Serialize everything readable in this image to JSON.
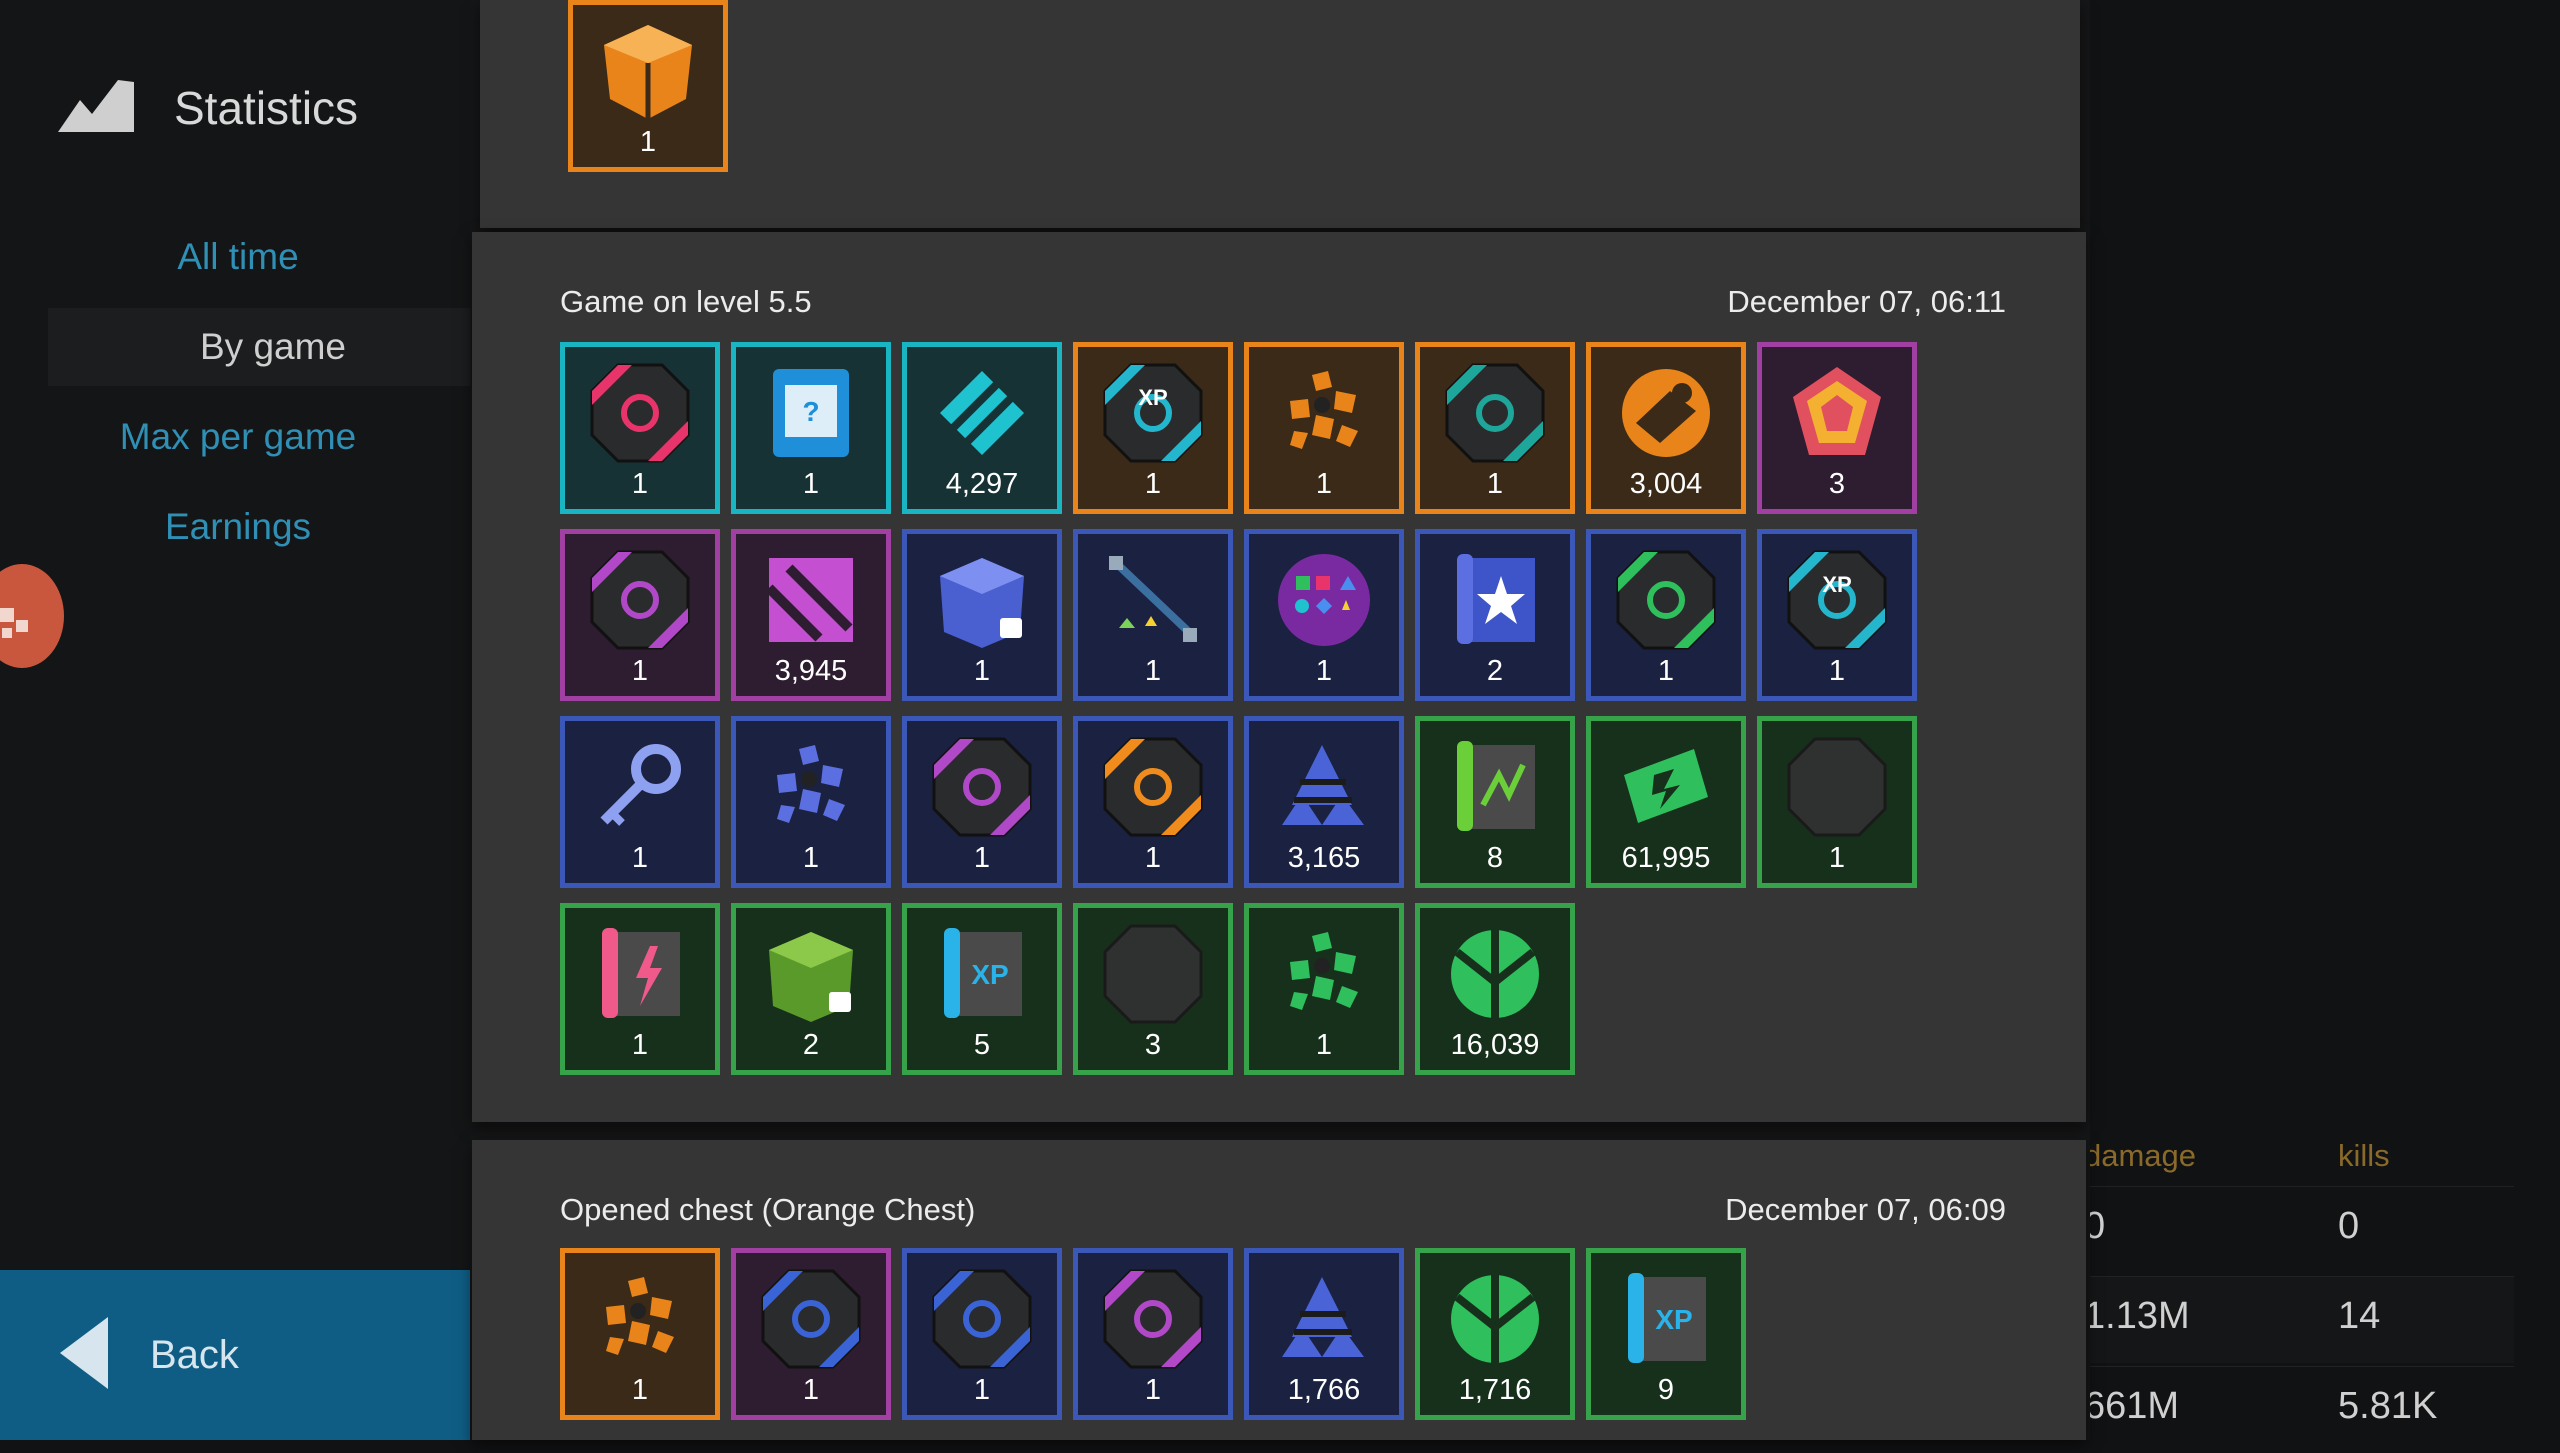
{
  "sidebar": {
    "title": "Statistics",
    "nav": [
      "All time",
      "By game",
      "Max per game",
      "Earnings"
    ],
    "active_nav": "By game",
    "back_label": "Back"
  },
  "top_card": {
    "items": [
      {
        "rarity": "orange",
        "icon": "orange-chest-icon",
        "count": "1"
      }
    ]
  },
  "game_card": {
    "title": "Game on level 5.5",
    "date": "December 07, 06:11",
    "items": [
      {
        "rarity": "cyan",
        "icon": "module-pink-icon",
        "count": "1"
      },
      {
        "rarity": "cyan",
        "icon": "booster-card-icon",
        "count": "1"
      },
      {
        "rarity": "cyan",
        "icon": "cyan-shards-icon",
        "count": "4,297"
      },
      {
        "rarity": "orange",
        "icon": "xp-module-icon",
        "count": "1"
      },
      {
        "rarity": "orange",
        "icon": "orange-gems-icon",
        "count": "1"
      },
      {
        "rarity": "orange",
        "icon": "module-teal-icon",
        "count": "1"
      },
      {
        "rarity": "orange",
        "icon": "orange-tokens-icon",
        "count": "3,004"
      },
      {
        "rarity": "purple",
        "icon": "purple-crystal-icon",
        "count": "3"
      },
      {
        "rarity": "purple",
        "icon": "module-purple-icon",
        "count": "1"
      },
      {
        "rarity": "purple",
        "icon": "purple-shards-icon",
        "count": "3,945"
      },
      {
        "rarity": "blue",
        "icon": "blue-locked-chest-icon",
        "count": "1"
      },
      {
        "rarity": "blue",
        "icon": "level-path-icon",
        "count": "1"
      },
      {
        "rarity": "blue",
        "icon": "gems-wheel-icon",
        "count": "1"
      },
      {
        "rarity": "blue",
        "icon": "star-blueprint-icon",
        "count": "2"
      },
      {
        "rarity": "blue",
        "icon": "module-green-icon",
        "count": "1"
      },
      {
        "rarity": "blue",
        "icon": "xp-module-icon",
        "count": "1"
      },
      {
        "rarity": "blue",
        "icon": "key-icon",
        "count": "1"
      },
      {
        "rarity": "blue",
        "icon": "blue-gems-icon",
        "count": "1"
      },
      {
        "rarity": "blue",
        "icon": "module-purple-icon",
        "count": "1"
      },
      {
        "rarity": "blue",
        "icon": "module-orange-icon",
        "count": "1"
      },
      {
        "rarity": "blue",
        "icon": "blue-shards-icon",
        "count": "3,165"
      },
      {
        "rarity": "green",
        "icon": "green-blueprint-icon",
        "count": "8"
      },
      {
        "rarity": "green",
        "icon": "green-cash-icon",
        "count": "61,995"
      },
      {
        "rarity": "green",
        "icon": "empty-module-icon",
        "count": "1"
      },
      {
        "rarity": "green",
        "icon": "pink-blueprint-icon",
        "count": "1"
      },
      {
        "rarity": "green",
        "icon": "green-locked-chest-icon",
        "count": "2"
      },
      {
        "rarity": "green",
        "icon": "xp-blueprint-icon",
        "count": "5"
      },
      {
        "rarity": "green",
        "icon": "empty-module-icon",
        "count": "3"
      },
      {
        "rarity": "green",
        "icon": "green-gems-icon",
        "count": "1"
      },
      {
        "rarity": "green",
        "icon": "green-shards-icon",
        "count": "16,039"
      }
    ]
  },
  "chest_card": {
    "title": "Opened chest (Orange Chest)",
    "date": "December 07, 06:09",
    "items": [
      {
        "rarity": "orange",
        "icon": "orange-gems-icon",
        "count": "1"
      },
      {
        "rarity": "purple",
        "icon": "module-blue-icon",
        "count": "1"
      },
      {
        "rarity": "blue",
        "icon": "module-blue-icon",
        "count": "1"
      },
      {
        "rarity": "blue",
        "icon": "module-purple-icon",
        "count": "1"
      },
      {
        "rarity": "blue",
        "icon": "blue-shards-icon",
        "count": "1,766"
      },
      {
        "rarity": "green",
        "icon": "green-shards-icon",
        "count": "1,716"
      },
      {
        "rarity": "green",
        "icon": "xp-blueprint-icon",
        "count": "9"
      }
    ]
  },
  "right_table": {
    "headers": [
      "damage",
      "kills"
    ],
    "rows": [
      [
        "0",
        "0"
      ],
      [
        "1.13M",
        "14"
      ],
      [
        "661M",
        "5.81K"
      ]
    ]
  },
  "colors": {
    "orange": "#e9841a",
    "cyan": "#1ab5c2",
    "purple": "#a23fa3",
    "blue": "#3b57b8",
    "green": "#36a34a",
    "link": "#2f8fb4",
    "back": "#0f5d85"
  }
}
